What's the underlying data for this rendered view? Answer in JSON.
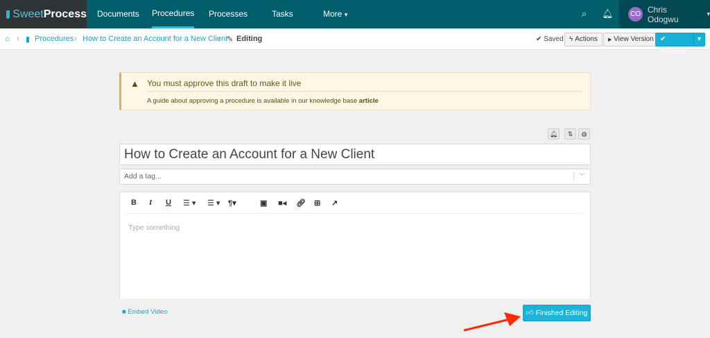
{
  "nav": {
    "logo_sweet": "Sweet",
    "logo_process": "Process",
    "items": [
      "Documents",
      "Procedures",
      "Processes",
      "Tasks",
      "More"
    ],
    "active": "Procedures",
    "user_initials": "CO",
    "user_name": "Chris Odogwu"
  },
  "breadcrumb": {
    "items": [
      "Procedures",
      "How to Create an Account for a New Client"
    ],
    "current": "Editing"
  },
  "toolbar": {
    "saved": "Saved",
    "actions": "Actions",
    "view_version": "View Version",
    "approve": "Approve"
  },
  "alert": {
    "title": "You must approve this draft to make it live",
    "text": "A guide about approving a procedure is available in our knowledge base",
    "link": "article"
  },
  "editor": {
    "title_value": "How to Create an Account for a New Client",
    "tag_placeholder": "Add a tag...",
    "body_placeholder": "Type something"
  },
  "footer": {
    "embed_video": "Embed Video",
    "finished": "Finished Editing"
  },
  "colors": {
    "nav": "#035e6b",
    "accent": "#19b4d8",
    "arrow": "#ff2a00"
  }
}
